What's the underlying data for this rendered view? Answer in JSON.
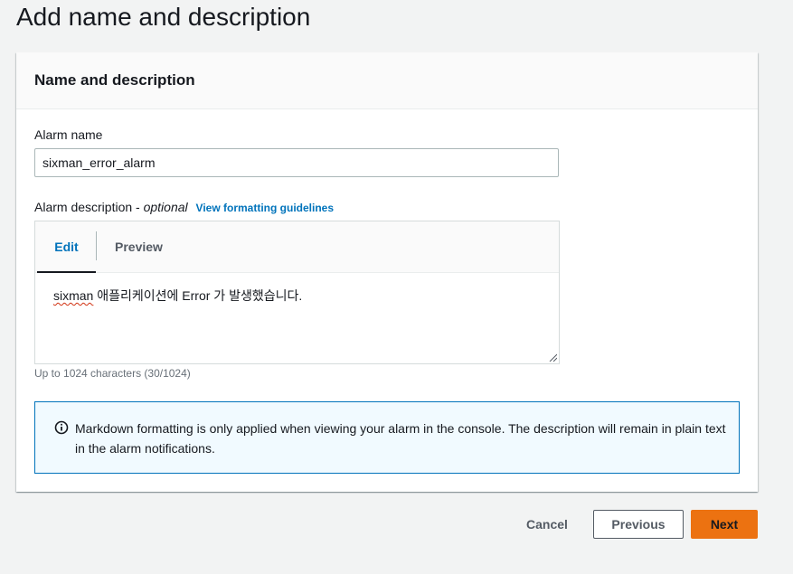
{
  "page": {
    "title": "Add name and description"
  },
  "card": {
    "header": "Name and description"
  },
  "alarm_name": {
    "label": "Alarm name",
    "value": "sixman_error_alarm"
  },
  "alarm_description": {
    "label": "Alarm description - ",
    "optional": "optional",
    "guidelines_link": "View formatting guidelines",
    "tabs": {
      "edit": "Edit",
      "preview": "Preview"
    },
    "value_word": "sixman",
    "value_rest": " 애플리케이션에 Error 가 발생했습니다.",
    "char_hint": "Up to 1024 characters (30/1024)"
  },
  "info_alert": {
    "icon": "info-circle-icon",
    "text": "Markdown formatting is only applied when viewing your alarm in the console. The description will remain in plain text in the alarm notifications."
  },
  "actions": {
    "cancel": "Cancel",
    "previous": "Previous",
    "next": "Next"
  },
  "colors": {
    "accent_link": "#0073bb",
    "primary_button": "#ec7211",
    "alert_border": "#0073bb",
    "alert_background": "#f1faff"
  }
}
